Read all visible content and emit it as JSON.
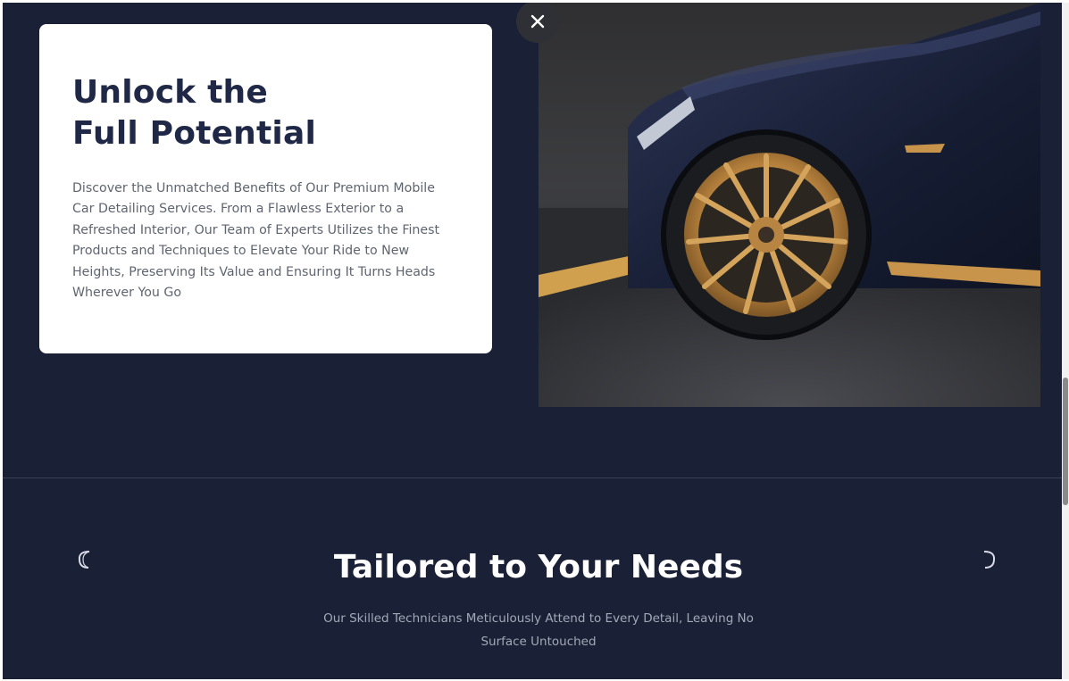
{
  "hero_card": {
    "title_line1": "Unlock the",
    "title_line2": "Full Potential",
    "body": "Discover the Unmatched Benefits of Our Premium Mobile Car Detailing Services. From a Flawless Exterior to a Refreshed Interior, Our Team of Experts Utilizes the Finest Products and Techniques to Elevate Your Ride to New Heights, Preserving Its Value and Ensuring It Turns Heads Wherever You Go"
  },
  "close_button": {
    "icon": "close-icon"
  },
  "car_image": {
    "icon": "car-wheel-photo"
  },
  "section": {
    "title": "Tailored to Your Needs",
    "subtitle": "Our Skilled Technicians Meticulously Attend to Every Detail, Leaving No Surface Untouched"
  },
  "carousel": {
    "prev_icon": "chevron-left-icon",
    "next_icon": "chevron-right-icon"
  },
  "colors": {
    "background": "#1a2036",
    "card": "#ffffff",
    "heading": "#1f2846",
    "accent_gold": "#c8934a"
  }
}
